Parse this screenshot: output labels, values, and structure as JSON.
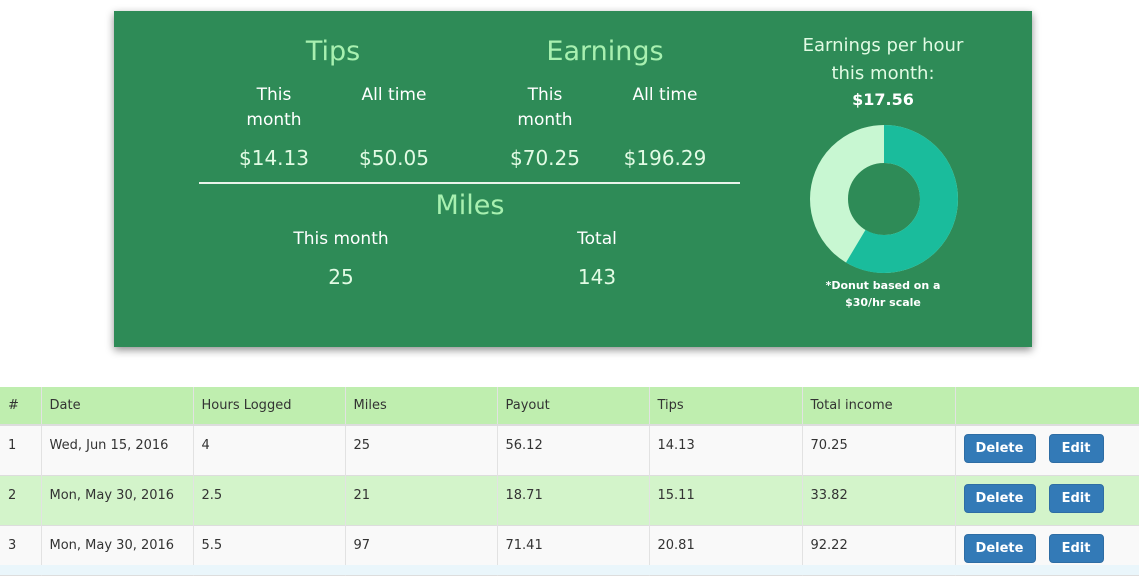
{
  "stats": {
    "tips": {
      "title": "Tips",
      "this_month_label": "This month",
      "all_time_label": "All time",
      "this_month_value": "$14.13",
      "all_time_value": "$50.05"
    },
    "earnings": {
      "title": "Earnings",
      "this_month_label": "This month",
      "all_time_label": "All time",
      "this_month_value": "$70.25",
      "all_time_value": "$196.29"
    },
    "miles": {
      "title": "Miles",
      "this_month_label": "This month",
      "total_label": "Total",
      "this_month_value": "25",
      "total_value": "143"
    },
    "earnings_per_hour": {
      "title_line1": "Earnings per hour",
      "title_line2": "this month:",
      "value": "$17.56",
      "donut_fraction": 0.5853,
      "donut_fill_color": "#1abc9c",
      "donut_remainder_color": "#c8f7d2",
      "note_line1": "*Donut based on a",
      "note_line2": "$30/hr scale"
    }
  },
  "table": {
    "headers": [
      "#",
      "Date",
      "Hours Logged",
      "Miles",
      "Payout",
      "Tips",
      "Total income",
      ""
    ],
    "rows": [
      {
        "num": "1",
        "date": "Wed, Jun 15, 2016",
        "hours": "4",
        "miles": "25",
        "payout": "56.12",
        "tips": "14.13",
        "total": "70.25"
      },
      {
        "num": "2",
        "date": "Mon, May 30, 2016",
        "hours": "2.5",
        "miles": "21",
        "payout": "18.71",
        "tips": "15.11",
        "total": "33.82"
      },
      {
        "num": "3",
        "date": "Mon, May 30, 2016",
        "hours": "5.5",
        "miles": "97",
        "payout": "71.41",
        "tips": "20.81",
        "total": "92.22"
      }
    ],
    "delete_label": "Delete",
    "edit_label": "Edit"
  },
  "colors": {
    "card_background": "#2e8b57",
    "header_row": "#bfeeaf",
    "button": "#337ab7"
  }
}
